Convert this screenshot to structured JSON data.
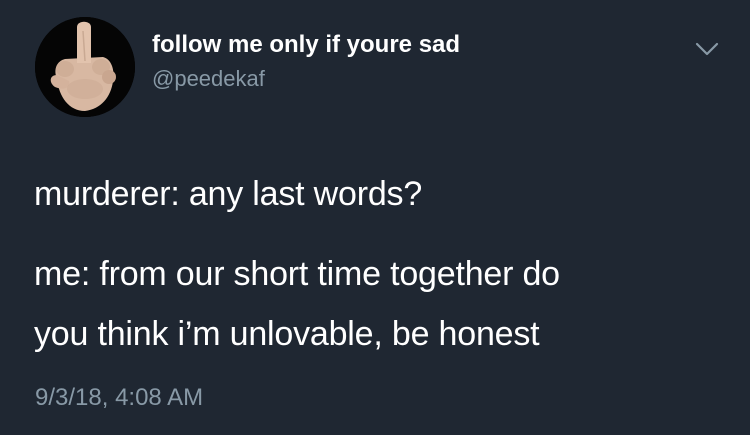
{
  "header": {
    "display_name": "follow me only if youre sad",
    "handle": "@peedekaf"
  },
  "icons": {
    "avatar": "middle-finger-hand-avatar",
    "menu": "chevron-down-icon"
  },
  "tweet": {
    "line_1": "murderer: any last words?",
    "line_2": "me: from our short time together do",
    "line_3": "you think i’m unlovable, be honest"
  },
  "meta": {
    "timestamp": "9/3/18, 4:08 AM"
  },
  "colors": {
    "background": "#1f2732",
    "text": "#ffffff",
    "secondary_text": "#8899a6"
  }
}
